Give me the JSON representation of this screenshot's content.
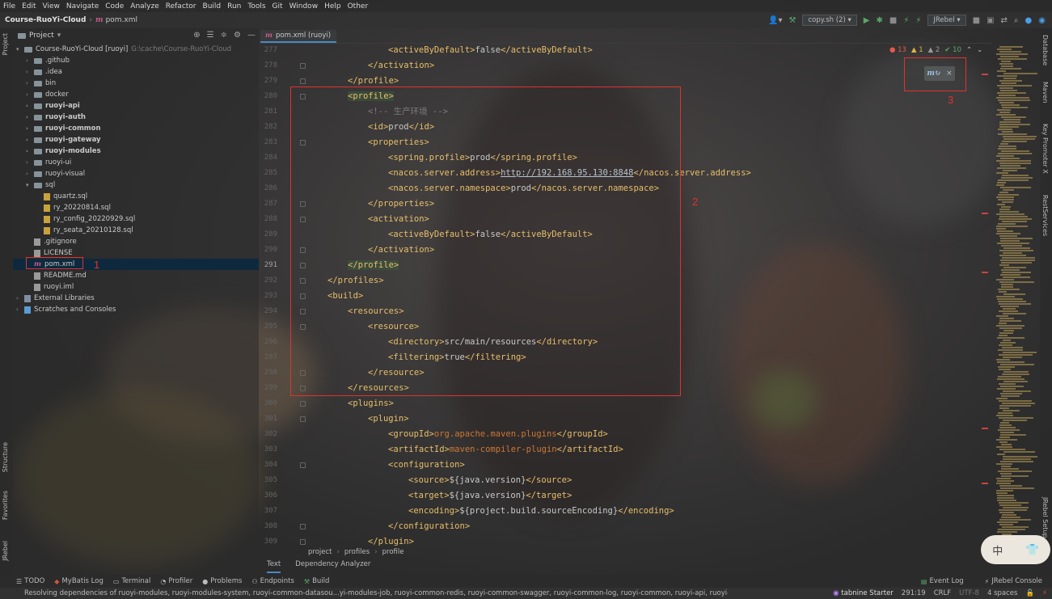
{
  "menu": [
    "File",
    "Edit",
    "View",
    "Navigate",
    "Code",
    "Analyze",
    "Refactor",
    "Build",
    "Run",
    "Tools",
    "Git",
    "Window",
    "Help",
    "Other"
  ],
  "nav": {
    "project": "Course-RuoYi-Cloud",
    "file": "pom.xml",
    "run_config": "copy.sh (2)",
    "jrebel": "JRebel"
  },
  "project_panel": {
    "title": "Project",
    "tree": [
      {
        "label": "Course-RuoYi-Cloud [ruoyi]",
        "hint": "G:\\cache\\Course-RuoYi-Cloud",
        "type": "folder",
        "bold": false,
        "expanded": true
      },
      {
        "label": ".github",
        "type": "folder"
      },
      {
        "label": ".idea",
        "type": "folder"
      },
      {
        "label": "bin",
        "type": "folder"
      },
      {
        "label": "docker",
        "type": "folder"
      },
      {
        "label": "ruoyi-api",
        "type": "folder",
        "bold": true
      },
      {
        "label": "ruoyi-auth",
        "type": "folder",
        "bold": true
      },
      {
        "label": "ruoyi-common",
        "type": "folder",
        "bold": true
      },
      {
        "label": "ruoyi-gateway",
        "type": "folder",
        "bold": true
      },
      {
        "label": "ruoyi-modules",
        "type": "folder",
        "bold": true
      },
      {
        "label": "ruoyi-ui",
        "type": "folder"
      },
      {
        "label": "ruoyi-visual",
        "type": "folder"
      },
      {
        "label": "sql",
        "type": "folder",
        "expanded": true
      },
      {
        "label": "quartz.sql",
        "type": "sql"
      },
      {
        "label": "ry_20220814.sql",
        "type": "sql"
      },
      {
        "label": "ry_config_20220929.sql",
        "type": "sql"
      },
      {
        "label": "ry_seata_20210128.sql",
        "type": "sql"
      },
      {
        "label": ".gitignore",
        "type": "file"
      },
      {
        "label": "LICENSE",
        "type": "file"
      },
      {
        "label": "pom.xml",
        "type": "maven",
        "selected": true
      },
      {
        "label": "README.md",
        "type": "file"
      },
      {
        "label": "ruoyi.iml",
        "type": "file"
      },
      {
        "label": "External Libraries",
        "type": "lib"
      },
      {
        "label": "Scratches and Consoles",
        "type": "scratch"
      }
    ]
  },
  "editor": {
    "tab": "pom.xml (ruoyi)",
    "inspections": {
      "errors": "13",
      "warnings": "1",
      "weak": "2",
      "ok": "10"
    },
    "lines": [
      {
        "n": "277",
        "indent": 4,
        "code": "<activeByDefault>false</activeByDefault>"
      },
      {
        "n": "278",
        "indent": 3,
        "code": "</activation>"
      },
      {
        "n": "279",
        "indent": 2,
        "code": "</profile>"
      },
      {
        "n": "280",
        "indent": 2,
        "code": "<profile>"
      },
      {
        "n": "281",
        "indent": 3,
        "code": "<!-- 生产环境 -->"
      },
      {
        "n": "282",
        "indent": 3,
        "code": "<id>prod</id>"
      },
      {
        "n": "283",
        "indent": 3,
        "code": "<properties>"
      },
      {
        "n": "284",
        "indent": 4,
        "code": "<spring.profile>prod</spring.profile>"
      },
      {
        "n": "285",
        "indent": 4,
        "code": "<nacos.server.address>http://192.168.95.130:8848</nacos.server.address>"
      },
      {
        "n": "286",
        "indent": 4,
        "code": "<nacos.server.namespace>prod</nacos.server.namespace>"
      },
      {
        "n": "287",
        "indent": 3,
        "code": "</properties>"
      },
      {
        "n": "288",
        "indent": 3,
        "code": "<activation>"
      },
      {
        "n": "289",
        "indent": 4,
        "code": "<activeByDefault>false</activeByDefault>"
      },
      {
        "n": "290",
        "indent": 3,
        "code": "</activation>"
      },
      {
        "n": "291",
        "indent": 2,
        "code": "</profile>"
      },
      {
        "n": "292",
        "indent": 1,
        "code": "</profiles>"
      },
      {
        "n": "293",
        "indent": 1,
        "code": "<build>"
      },
      {
        "n": "294",
        "indent": 2,
        "code": "<resources>"
      },
      {
        "n": "295",
        "indent": 3,
        "code": "<resource>"
      },
      {
        "n": "296",
        "indent": 4,
        "code": "<directory>src/main/resources</directory>"
      },
      {
        "n": "297",
        "indent": 4,
        "code": "<filtering>true</filtering>"
      },
      {
        "n": "298",
        "indent": 3,
        "code": "</resource>"
      },
      {
        "n": "299",
        "indent": 2,
        "code": "</resources>"
      },
      {
        "n": "300",
        "indent": 2,
        "code": "<plugins>"
      },
      {
        "n": "301",
        "indent": 3,
        "code": "<plugin>"
      },
      {
        "n": "302",
        "indent": 4,
        "code": "<groupId>org.apache.maven.plugins</groupId>"
      },
      {
        "n": "303",
        "indent": 4,
        "code": "<artifactId>maven-compiler-plugin</artifactId>"
      },
      {
        "n": "304",
        "indent": 4,
        "code": "<configuration>"
      },
      {
        "n": "305",
        "indent": 5,
        "code": "<source>${java.version}</source>"
      },
      {
        "n": "306",
        "indent": 5,
        "code": "<target>${java.version}</target>"
      },
      {
        "n": "307",
        "indent": 5,
        "code": "<encoding>${project.build.sourceEncoding}</encoding>"
      },
      {
        "n": "308",
        "indent": 4,
        "code": "</configuration>"
      },
      {
        "n": "309",
        "indent": 3,
        "code": "</plugin>"
      }
    ],
    "breadcrumb": [
      "project",
      "profiles",
      "profile"
    ],
    "bottom_tabs": [
      "Text",
      "Dependency Analyzer"
    ]
  },
  "annotations": [
    "1",
    "2",
    "3"
  ],
  "left_stripe": [
    "Project",
    "Structure",
    "Favorites",
    "JRebel"
  ],
  "right_stripe": [
    "Database",
    "Maven",
    "Key Promoter X",
    "RestServices",
    "JRebel Setup"
  ],
  "tool_windows": [
    "TODO",
    "MyBatis Log",
    "Terminal",
    "Profiler",
    "Problems",
    "Endpoints",
    "Build"
  ],
  "tool_windows_right": [
    "Event Log",
    "JRebel Console"
  ],
  "status": {
    "message": "Resolving dependencies of ruoyi-modules, ruoyi-modules-system, ruoyi-common-datasou...yi-modules-job, ruoyi-common-redis, ruoyi-common-swagger, ruoyi-common-log, ruoyi-common, ruoyi-api, ruoyi-visual-m...",
    "tabnine": "tabnine Starter",
    "position": "291:19",
    "line_sep": "CRLF",
    "encoding": "UTF-8",
    "indent": "4 spaces"
  },
  "ime": {
    "lang": "中",
    "icon": "shirt-icon"
  }
}
